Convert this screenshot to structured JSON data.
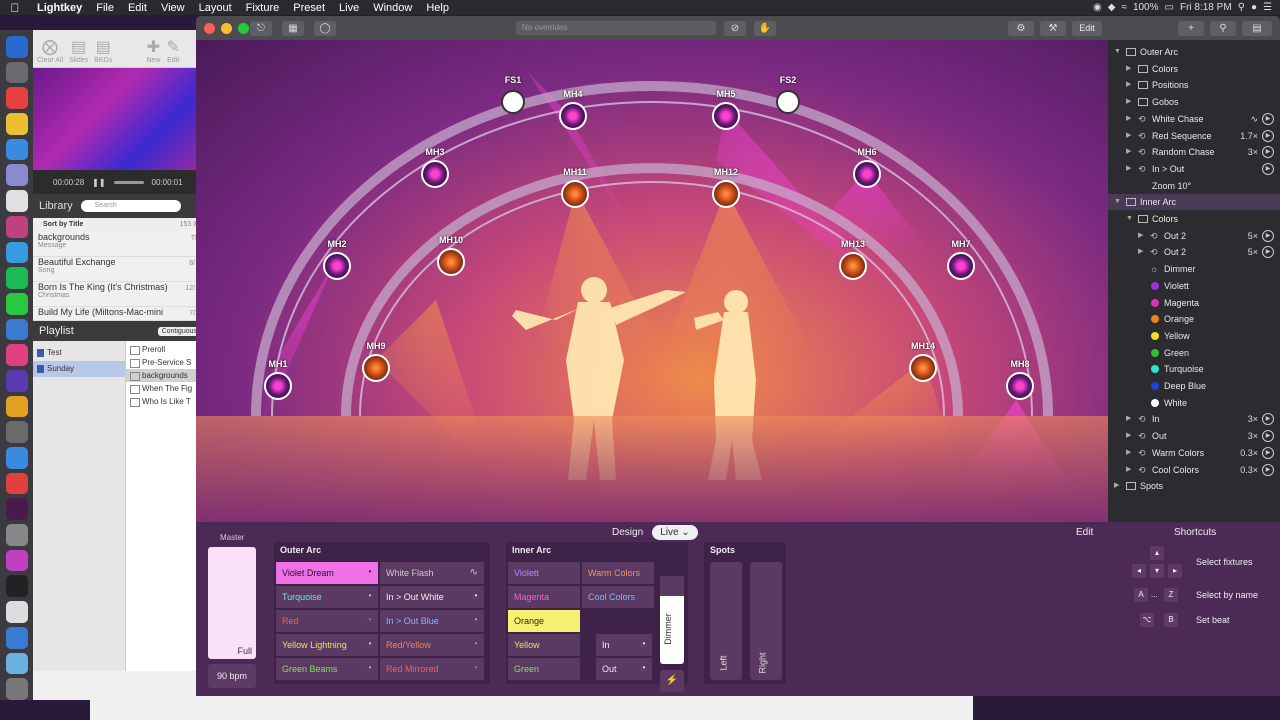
{
  "menubar": {
    "app": "Lightkey",
    "items": [
      "File",
      "Edit",
      "View",
      "Layout",
      "Fixture",
      "Preset",
      "Live",
      "Window",
      "Help"
    ],
    "battery": "100%",
    "clock": "Fri 8:18 PM"
  },
  "bgapp": {
    "toolbar": [
      {
        "label": "Clear All",
        "icon": "clear-icon"
      },
      {
        "label": "Slides",
        "icon": "slides-icon"
      },
      {
        "label": "BKGs",
        "icon": "backgrounds-icon"
      },
      {
        "label": "New",
        "icon": "plus-icon"
      },
      {
        "label": "Edit",
        "icon": "edit-icon"
      }
    ],
    "transport": {
      "elapsed": "00:00:28",
      "remaining": "00:00:01"
    },
    "library_title": "Library",
    "search_placeholder": "Search",
    "sort_label": "Sort by Title",
    "sort_count": "153 It",
    "library_items": [
      {
        "title": "backgrounds",
        "sub": "Message",
        "date": "Th"
      },
      {
        "title": "Beautiful Exchange",
        "sub": "Song",
        "date": "8/1"
      },
      {
        "title": "Born Is The King (It's Christmas)",
        "sub": "Christmas",
        "date": "12/1"
      },
      {
        "title": "Build My Life (Miltons-Mac-mini",
        "sub": "",
        "date": "7/2"
      }
    ],
    "playlist_title": "Playlist",
    "playlist_mode": "Contiguous",
    "playlists": [
      "Test",
      "Sunday"
    ],
    "playlist_items": [
      "Preroll",
      "Pre-Service S",
      "backgrounds",
      "When The Fig",
      "Who Is Like T"
    ]
  },
  "lightkey": {
    "overrides": "No overrides",
    "edit_label": "Edit",
    "fixtures": [
      {
        "id": "FS1",
        "type": "fs"
      },
      {
        "id": "FS2",
        "type": "fs"
      },
      {
        "id": "MH1",
        "type": "mh-out"
      },
      {
        "id": "MH2",
        "type": "mh-out"
      },
      {
        "id": "MH3",
        "type": "mh-out"
      },
      {
        "id": "MH4",
        "type": "mh-out"
      },
      {
        "id": "MH5",
        "type": "mh-out"
      },
      {
        "id": "MH6",
        "type": "mh-out"
      },
      {
        "id": "MH7",
        "type": "mh-out"
      },
      {
        "id": "MH8",
        "type": "mh-out"
      },
      {
        "id": "MH9",
        "type": "mh-in"
      },
      {
        "id": "MH10",
        "type": "mh-in"
      },
      {
        "id": "MH11",
        "type": "mh-in"
      },
      {
        "id": "MH12",
        "type": "mh-in"
      },
      {
        "id": "MH13",
        "type": "mh-in"
      },
      {
        "id": "MH14",
        "type": "mh-in"
      }
    ],
    "bottom": {
      "tab_design": "Design",
      "tab_live": "Live",
      "edit": "Edit",
      "master_label": "Master",
      "master_value": "Full",
      "bpm": "90 bpm",
      "outer_arc": {
        "title": "Outer Arc",
        "cues": [
          {
            "label": "Violet Dream",
            "color": "#f070e8",
            "text": "#2a0a2a",
            "active": true
          },
          {
            "label": "White Flash",
            "color": "#5a3a62",
            "text": "#ccc"
          },
          {
            "label": "Turquoise",
            "color": "#5a3a62",
            "text": "#5ef0e0"
          },
          {
            "label": "In > Out White",
            "color": "#5a3a62",
            "text": "#eee"
          },
          {
            "label": "Red",
            "color": "#5a3a62",
            "text": "#f06060"
          },
          {
            "label": "In > Out Blue",
            "color": "#5a3a62",
            "text": "#8ab0ff"
          },
          {
            "label": "Yellow Lightning",
            "color": "#5a3a62",
            "text": "#e8e060"
          },
          {
            "label": "Red/Yellow",
            "color": "#5a3a62",
            "text": "#f08060"
          },
          {
            "label": "Green Beams",
            "color": "#5a3a62",
            "text": "#7ee060"
          },
          {
            "label": "Red Mirrored",
            "color": "#5a3a62",
            "text": "#f06060"
          }
        ]
      },
      "inner_arc": {
        "title": "Inner Arc",
        "cues": [
          {
            "label": "Violett",
            "color": "#5a3a62",
            "text": "#c080ff"
          },
          {
            "label": "Warm Colors",
            "color": "#5a3a62",
            "text": "#f09060"
          },
          {
            "label": "Magenta",
            "color": "#5a3a62",
            "text": "#f060d0"
          },
          {
            "label": "Cool Colors",
            "color": "#5a3a62",
            "text": "#8ab0ff"
          },
          {
            "label": "Orange",
            "color": "#f8f070",
            "text": "#2a2a0a",
            "active": true
          },
          {
            "label": "Yellow",
            "color": "#5a3a62",
            "text": "#e8e060"
          },
          {
            "label": "In",
            "color": "#5a3a62",
            "text": "#eee"
          },
          {
            "label": "Green",
            "color": "#5a3a62",
            "text": "#7ee060"
          },
          {
            "label": "Out",
            "color": "#5a3a62",
            "text": "#eee"
          }
        ],
        "dimmer_label": "Dimmer"
      },
      "spots": {
        "title": "Spots",
        "left": "Left",
        "right": "Right"
      }
    },
    "sidebar": [
      {
        "label": "Outer Arc",
        "level": 0,
        "open": true,
        "icon": "folder"
      },
      {
        "label": "Colors",
        "level": 1,
        "icon": "folder"
      },
      {
        "label": "Positions",
        "level": 1,
        "icon": "folder"
      },
      {
        "label": "Gobos",
        "level": 1,
        "icon": "folder"
      },
      {
        "label": "White Chase",
        "level": 1,
        "icon": "loop",
        "rate": "",
        "pulse": true,
        "play": true
      },
      {
        "label": "Red Sequence",
        "level": 1,
        "icon": "loop",
        "rate": "1.7×",
        "play": true
      },
      {
        "label": "Random Chase",
        "level": 1,
        "icon": "loop",
        "rate": "3×",
        "play": true
      },
      {
        "label": "In > Out",
        "level": 1,
        "icon": "loop",
        "rate": "",
        "play": true
      },
      {
        "label": "Zoom 10°",
        "level": 1,
        "icon": "none"
      },
      {
        "label": "Inner Arc",
        "level": 0,
        "open": true,
        "icon": "folder",
        "selected": true
      },
      {
        "label": "Colors",
        "level": 1,
        "open": true,
        "icon": "folder"
      },
      {
        "label": "Out 2",
        "level": 2,
        "icon": "loop",
        "rate": "5×",
        "play": true
      },
      {
        "label": "Out 2",
        "level": 2,
        "icon": "loop",
        "rate": "5×",
        "play": true
      },
      {
        "label": "Dimmer",
        "level": 2,
        "icon": "sun"
      },
      {
        "label": "Violett",
        "level": 2,
        "icon": "dot",
        "color": "#9a30e0"
      },
      {
        "label": "Magenta",
        "level": 2,
        "icon": "dot",
        "color": "#e030b0"
      },
      {
        "label": "Orange",
        "level": 2,
        "icon": "dot",
        "color": "#f08020"
      },
      {
        "label": "Yellow",
        "level": 2,
        "icon": "dot",
        "color": "#f0e020"
      },
      {
        "label": "Green",
        "level": 2,
        "icon": "dot",
        "color": "#30c030"
      },
      {
        "label": "Turquoise",
        "level": 2,
        "icon": "dot",
        "color": "#30e0d0"
      },
      {
        "label": "Deep Blue",
        "level": 2,
        "icon": "dot",
        "color": "#2040e0"
      },
      {
        "label": "White",
        "level": 2,
        "icon": "dot",
        "color": "#ffffff"
      },
      {
        "label": "In",
        "level": 1,
        "icon": "loop",
        "rate": "3×",
        "play": true
      },
      {
        "label": "Out",
        "level": 1,
        "icon": "loop",
        "rate": "3×",
        "play": true
      },
      {
        "label": "Warm Colors",
        "level": 1,
        "icon": "loop",
        "rate": "0.3×",
        "play": true
      },
      {
        "label": "Cool Colors",
        "level": 1,
        "icon": "loop",
        "rate": "0.3×",
        "play": true
      },
      {
        "label": "Spots",
        "level": 0,
        "icon": "folder"
      }
    ],
    "shortcuts": {
      "title": "Shortcuts",
      "select_fixtures": "Select fixtures",
      "select_by_name": "Select by name",
      "set_beat": "Set beat",
      "key_a": "A",
      "key_ellipsis": "...",
      "key_z": "Z",
      "key_b": "B"
    }
  }
}
